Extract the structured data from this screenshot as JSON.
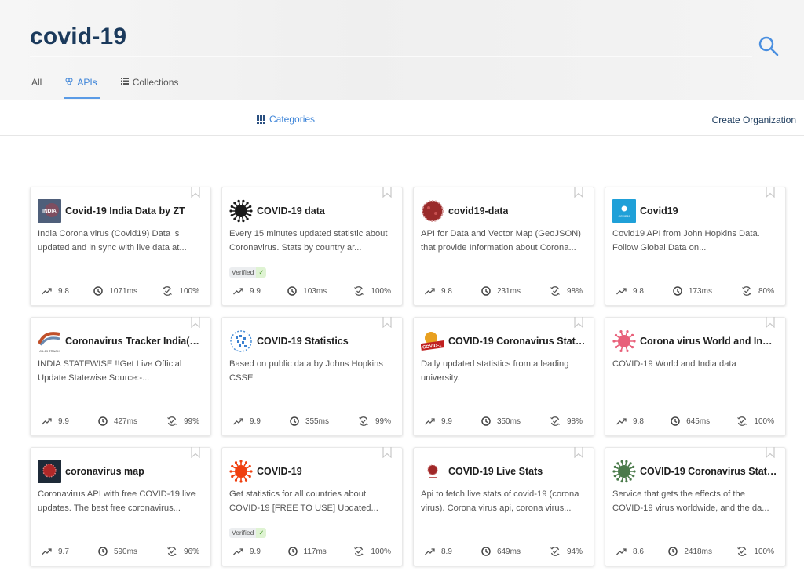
{
  "search": {
    "query": "covid-19",
    "button_icon": "search-icon"
  },
  "tabs": [
    {
      "label": "All",
      "icon": "",
      "active": false
    },
    {
      "label": "APIs",
      "icon": "api-icon",
      "active": true
    },
    {
      "label": "Collections",
      "icon": "list-icon",
      "active": false
    }
  ],
  "toolbar": {
    "categories_label": "Categories",
    "categories_icon": "grid-icon",
    "create_org_label": "Create Organization"
  },
  "colors": {
    "accent": "#3d84d8",
    "title_dark": "#1b3a5c",
    "verified_green": "#55a23a"
  },
  "cards": [
    {
      "title": "Covid-19 India Data by ZT",
      "description": "India Corona virus (Covid19) Data is updated and in sync with live data at...",
      "verified": false,
      "popularity": "9.8",
      "latency": "1071ms",
      "success": "100%",
      "logo": "india-logo"
    },
    {
      "title": "COVID-19 data",
      "description": "Every 15 minutes updated statistic about Coronavirus. Stats by country ar...",
      "verified": true,
      "popularity": "9.9",
      "latency": "103ms",
      "success": "100%",
      "logo": "black-virus-logo"
    },
    {
      "title": "covid19-data",
      "description": "API for Data and Vector Map (GeoJSON) that provide Information about Corona...",
      "verified": false,
      "popularity": "9.8",
      "latency": "231ms",
      "success": "98%",
      "logo": "red-virus-logo"
    },
    {
      "title": "Covid19",
      "description": "Covid19 API from John Hopkins Data. Follow Global Data on...",
      "verified": false,
      "popularity": "9.8",
      "latency": "173ms",
      "success": "80%",
      "logo": "blue-square-logo"
    },
    {
      "title": "Coronavirus Tracker India(Co...",
      "description": "INDIA STATEWISE !!Get Live Official Update Statewise Source:-...",
      "verified": false,
      "popularity": "9.9",
      "latency": "427ms",
      "success": "99%",
      "logo": "dna-tracker-logo"
    },
    {
      "title": "COVID-19 Statistics",
      "description": "Based on public data by Johns Hopkins CSSE",
      "verified": false,
      "popularity": "9.9",
      "latency": "355ms",
      "success": "99%",
      "logo": "blue-dots-globe-logo"
    },
    {
      "title": "COVID-19 Coronavirus Stati...",
      "description": "Daily updated statistics from a leading university.",
      "verified": false,
      "popularity": "9.9",
      "latency": "350ms",
      "success": "98%",
      "logo": "covid19-banner-logo"
    },
    {
      "title": "Corona virus World and India...",
      "description": "COVID-19 World and India data",
      "verified": false,
      "popularity": "9.8",
      "latency": "645ms",
      "success": "100%",
      "logo": "pink-virus-logo"
    },
    {
      "title": "coronavirus map",
      "description": "Coronavirus API with free COVID-19 live updates. The best free coronavirus...",
      "verified": false,
      "popularity": "9.7",
      "latency": "590ms",
      "success": "96%",
      "logo": "dark-map-logo"
    },
    {
      "title": "COVID-19",
      "description": "Get statistics for all countries about COVID-19 [FREE TO USE] Updated...",
      "verified": true,
      "popularity": "9.9",
      "latency": "117ms",
      "success": "100%",
      "logo": "orange-virus-logo"
    },
    {
      "title": "COVID-19 Live Stats",
      "description": "Api to fetch live stats of covid-19 (corona virus). Corona virus api, corona virus...",
      "verified": false,
      "popularity": "8.9",
      "latency": "649ms",
      "success": "94%",
      "logo": "small-red-virus-logo"
    },
    {
      "title": "COVID-19 Coronavirus Stati...",
      "description": "Service that gets the effects of the COVID-19 virus worldwide, and the da...",
      "verified": false,
      "popularity": "8.6",
      "latency": "2418ms",
      "success": "100%",
      "logo": "green-virus-logo"
    }
  ],
  "verified_label": "Verified",
  "verified_check": "✓"
}
